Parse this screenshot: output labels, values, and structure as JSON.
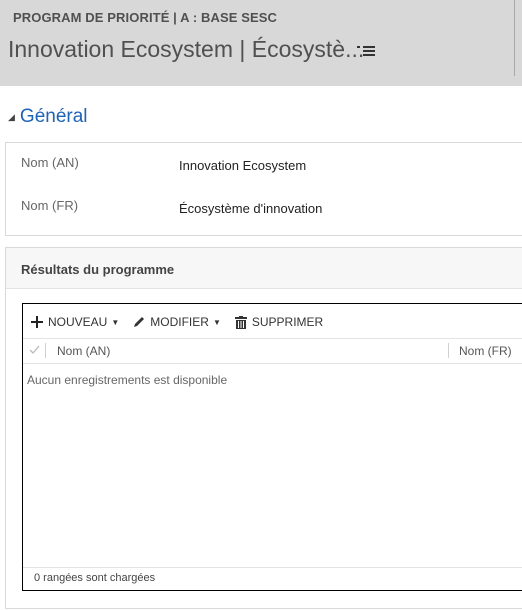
{
  "header": {
    "entity_label": "PROGRAM DE PRIORITÉ | A : BASE SESC",
    "record_title": "Innovation Ecosystem | Écosystè...",
    "menu_icon": "list-menu-icon"
  },
  "section": {
    "title": "Général",
    "collapse_icon": "triangle-collapse-icon"
  },
  "fields": [
    {
      "label": "Nom (AN)",
      "value": "Innovation Ecosystem"
    },
    {
      "label": "Nom (FR)",
      "value": "Écosystème d'innovation"
    }
  ],
  "subgrid": {
    "title": "Résultats du programme",
    "toolbar": {
      "new_label": "NOUVEAU",
      "edit_label": "MODIFIER",
      "delete_label": "SUPPRIMER"
    },
    "columns": [
      "Nom (AN)",
      "Nom (FR)"
    ],
    "empty_message": "Aucun enregistrements est disponible",
    "footer_text": "0 rangées sont chargées"
  },
  "colors": {
    "header_bg": "#d8d8d8",
    "accent": "#1e63b6"
  }
}
